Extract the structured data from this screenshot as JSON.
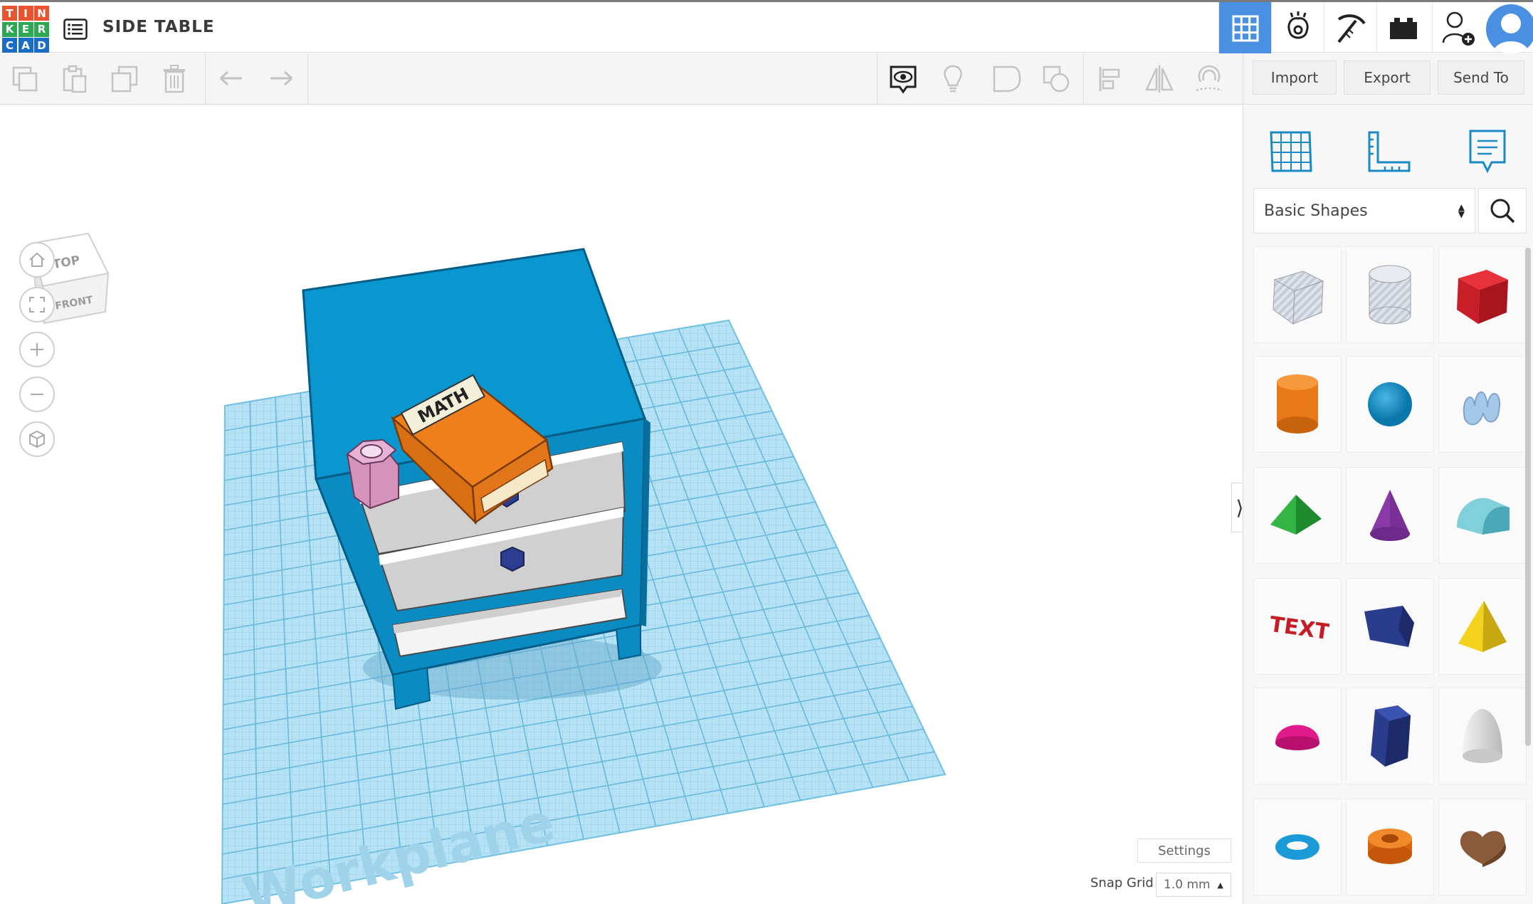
{
  "app": {
    "logo_letters": [
      "T",
      "I",
      "N",
      "K",
      "E",
      "R",
      "C",
      "A",
      "D"
    ],
    "logo_colors": [
      "#e8542f",
      "#e8542f",
      "#e8542f",
      "#2fa855",
      "#2fa855",
      "#2fa855",
      "#1a6cc4",
      "#1a6cc4",
      "#1a6cc4"
    ],
    "design_title": "SIDE TABLE"
  },
  "toolbar": {
    "import_label": "Import",
    "export_label": "Export",
    "send_to_label": "Send To"
  },
  "viewcube": {
    "top_label": "TOP",
    "front_label": "FRONT"
  },
  "scene": {
    "workplane_label": "Workplane",
    "book_label": "MATH"
  },
  "canvas_footer": {
    "settings_label": "Settings",
    "snap_grid_label": "Snap Grid",
    "snap_grid_value": "1.0 mm"
  },
  "panel": {
    "shape_category": "Basic Shapes",
    "shapes": [
      "box-hole",
      "cylinder-hole",
      "box",
      "cylinder",
      "sphere",
      "scribble",
      "roof",
      "cone",
      "round-roof",
      "text",
      "shape-generator",
      "pyramid",
      "half-sphere",
      "polygon",
      "paraboloid",
      "torus",
      "tube",
      "heart"
    ]
  },
  "colors": {
    "accent": "#4a90e2",
    "workplane": "#b6e2f5",
    "table_blue": "#0a97d0",
    "book_orange": "#ef7f1a"
  }
}
